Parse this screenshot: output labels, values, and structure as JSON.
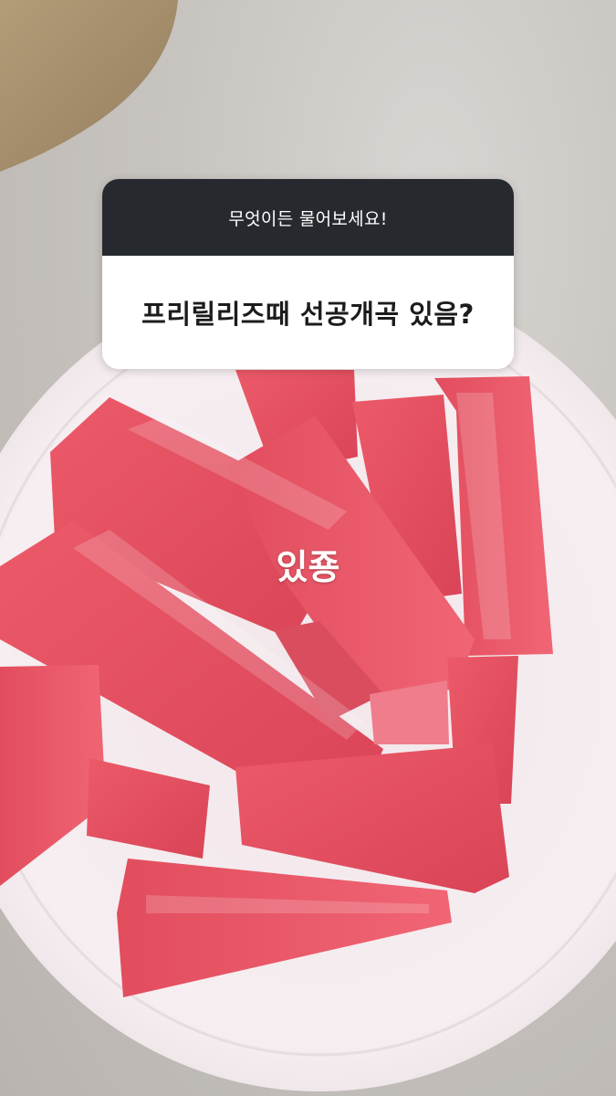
{
  "question_sticker": {
    "prompt": "무엇이든 물어보세요!",
    "question": "프리릴리즈때 선공개곡 있음?"
  },
  "answer": {
    "text": "있죵"
  },
  "photo": {
    "subject": "watermelon-sticks-on-plate",
    "colors": {
      "watermelon": "#e5505f",
      "plate": "#f4ecef",
      "paper_bag": "#a8916f",
      "header": "#262a2e"
    }
  }
}
